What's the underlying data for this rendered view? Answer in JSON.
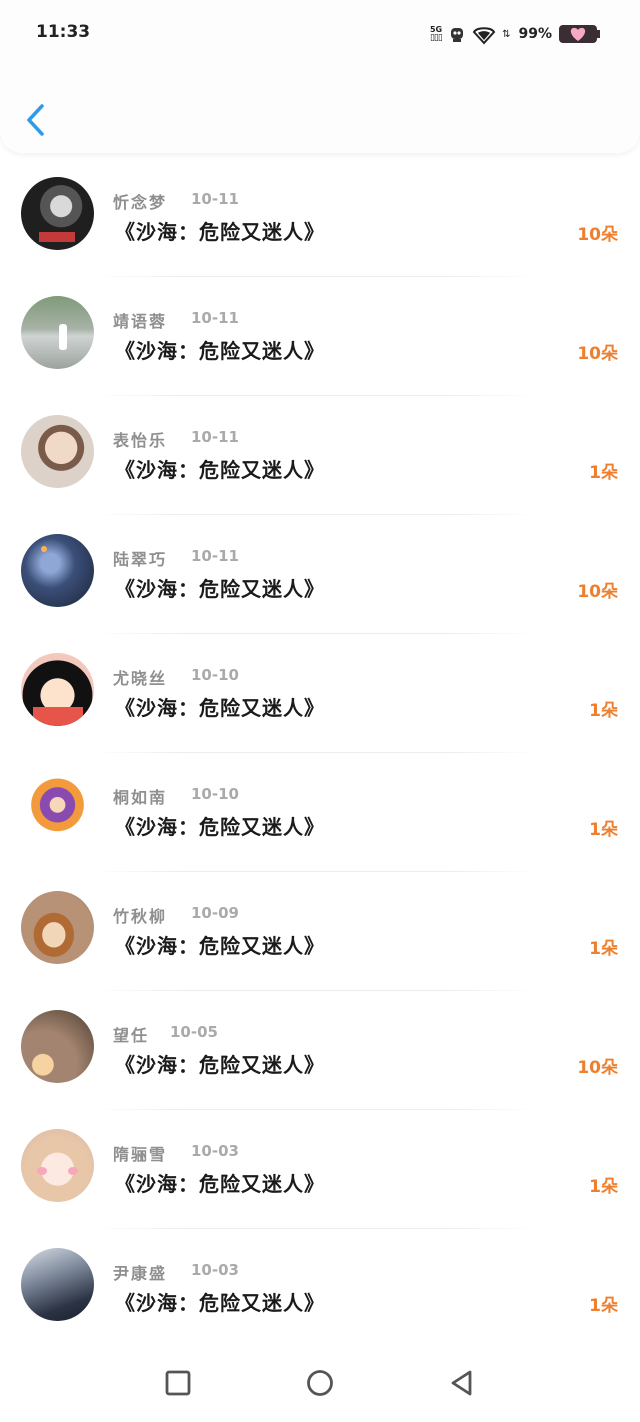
{
  "status_bar": {
    "time": "11:33",
    "network": "5G",
    "battery": "99%"
  },
  "rows": [
    {
      "name": "忻念梦",
      "date": "10-11",
      "title": "《沙海：危险又迷人》",
      "amount": "10朵",
      "avatar_color": "#2a2a2a"
    },
    {
      "name": "靖语蓉",
      "date": "10-11",
      "title": "《沙海：危险又迷人》",
      "amount": "10朵",
      "avatar_color": "#8a9388"
    },
    {
      "name": "表怡乐",
      "date": "10-11",
      "title": "《沙海：危险又迷人》",
      "amount": "1朵",
      "avatar_color": "#c9b7a7"
    },
    {
      "name": "陆翠巧",
      "date": "10-11",
      "title": "《沙海：危险又迷人》",
      "amount": "10朵",
      "avatar_color": "#3b4f78"
    },
    {
      "name": "尤晓丝",
      "date": "10-10",
      "title": "《沙海：危险又迷人》",
      "amount": "1朵",
      "avatar_color": "#f2c7b6"
    },
    {
      "name": "桐如南",
      "date": "10-10",
      "title": "《沙海：危险又迷人》",
      "amount": "1朵",
      "avatar_color": "#d8a46a"
    },
    {
      "name": "竹秋柳",
      "date": "10-09",
      "title": "《沙海：危险又迷人》",
      "amount": "1朵",
      "avatar_color": "#9b7453"
    },
    {
      "name": "望任",
      "date": "10-05",
      "title": "《沙海：危险又迷人》",
      "amount": "10朵",
      "avatar_color": "#6b5a4a"
    },
    {
      "name": "隋骊雪",
      "date": "10-03",
      "title": "《沙海：危险又迷人》",
      "amount": "1朵",
      "avatar_color": "#e9d7c9"
    },
    {
      "name": "尹康盛",
      "date": "10-03",
      "title": "《沙海：危险又迷人》",
      "amount": "1朵",
      "avatar_color": "#3c4357"
    }
  ],
  "colors": {
    "accent": "#2f9be8",
    "amount": "#ee7f2f"
  }
}
